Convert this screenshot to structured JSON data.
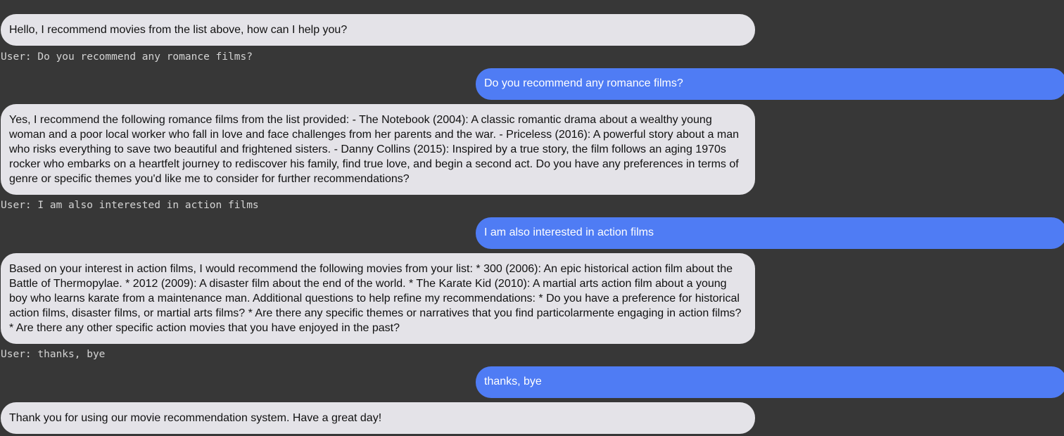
{
  "messages": {
    "bot_1": "Hello, I recommend movies from the list above, how can I help you?",
    "console_1": "User: Do you recommend any romance films?",
    "user_1": "Do you recommend any romance films?",
    "bot_2": "Yes, I recommend the following romance films from the list provided: - The Notebook (2004): A classic romantic drama about a wealthy young woman and a poor local worker who fall in love and face challenges from her parents and the war. - Priceless (2016): A powerful story about a man who risks everything to save two beautiful and frightened sisters. - Danny Collins (2015): Inspired by a true story, the film follows an aging 1970s rocker who embarks on a heartfelt journey to rediscover his family, find true love, and begin a second act. Do you have any preferences in terms of genre or specific themes you'd like me to consider for further recommendations?",
    "console_2": "User: I am also interested in action films",
    "user_2": "I am also interested in action films",
    "bot_3": "Based on your interest in action films, I would recommend the following movies from your list: * 300 (2006): An epic historical action film about the Battle of Thermopylae. * 2012 (2009): A disaster film about the end of the world. * The Karate Kid (2010): A martial arts action film about a young boy who learns karate from a maintenance man. Additional questions to help refine my recommendations: * Do you have a preference for historical action films, disaster films, or martial arts films? * Are there any specific themes or narratives that you find particolarmente engaging in action films? * Are there any other specific action movies that you have enjoyed in the past?",
    "console_3": "User: thanks, bye",
    "user_3": "thanks, bye",
    "bot_4": "Thank you for using our movie recommendation system. Have a great day!"
  },
  "colors": {
    "background": "#373737",
    "bot_bubble": "#e4e3e8",
    "user_bubble": "#4f7cf4",
    "console_text": "#d4d4d4"
  }
}
